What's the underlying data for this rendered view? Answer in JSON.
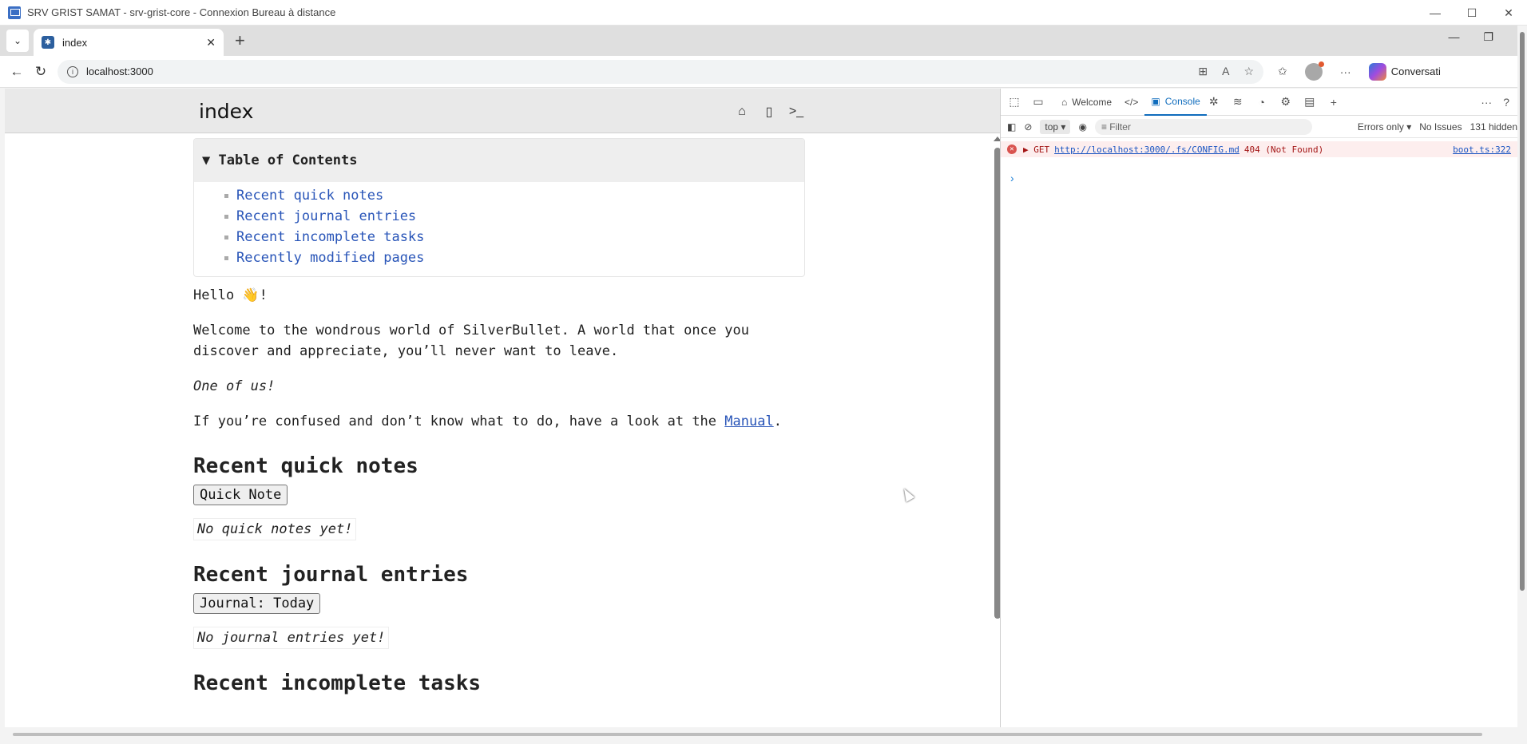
{
  "window": {
    "title": "SRV GRIST SAMAT - srv-grist-core - Connexion Bureau à distance",
    "minimize": "—",
    "maximize": "☐",
    "close": "✕"
  },
  "browser": {
    "tab_title": "index",
    "tab_close": "✕",
    "new_tab": "+",
    "url": "localhost:3000",
    "copilot_label": "Conversati"
  },
  "silverbullet": {
    "page_title": "index",
    "toc_title": "▼ Table of Contents",
    "toc_items": [
      "Recent quick notes",
      "Recent journal entries",
      "Recent incomplete tasks",
      "Recently modified pages"
    ],
    "hello": "Hello 👋!",
    "welcome": "Welcome to the wondrous world of SilverBullet. A world that once you discover and appreciate, you’ll never want to leave.",
    "one_of_us": "One of us!",
    "confused_prefix": "If you’re confused and don’t know what to do, have a look at the",
    "manual_link": "Manual",
    "confused_suffix": ".",
    "sections": [
      {
        "heading": "Recent quick notes",
        "button": "Quick Note",
        "empty": "No quick notes yet!"
      },
      {
        "heading": "Recent journal entries",
        "button": "Journal: Today",
        "empty": "No journal entries yet!"
      }
    ],
    "next_heading_partial": "Recent incomplete tasks"
  },
  "devtools": {
    "tabs": [
      "Welcome",
      "Console"
    ],
    "active_tab": "Console",
    "context": "top ▾",
    "filter_placeholder": "Filter",
    "levels": "Errors only ▾",
    "issues": "No Issues",
    "hidden": "131 hidden",
    "error": {
      "method": "▶ GET",
      "url": "http://localhost:3000/.fs/CONFIG.md",
      "status": "404 (Not Found)",
      "source": "boot.ts:322"
    },
    "prompt": "›"
  }
}
